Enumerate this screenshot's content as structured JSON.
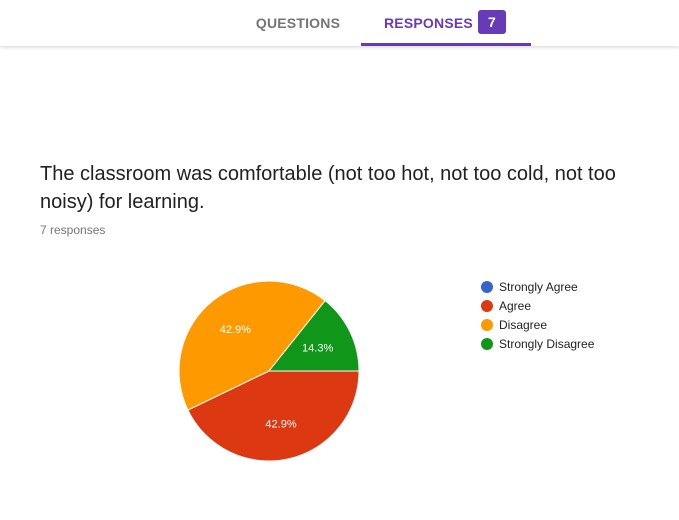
{
  "tabs": {
    "questions_label": "QUESTIONS",
    "responses_label": "RESPONSES",
    "responses_count": "7"
  },
  "question": {
    "title": "The classroom was comfortable (not too hot, not too cold, not too noisy) for learning.",
    "response_count": "7 responses"
  },
  "chart_data": {
    "type": "pie",
    "legend_position": "right",
    "slices": [
      {
        "label": "Strongly Agree",
        "value": 0,
        "percent_label": "",
        "color": "#3366cc"
      },
      {
        "label": "Agree",
        "value": 42.9,
        "percent_label": "42.9%",
        "color": "#dc3912"
      },
      {
        "label": "Disagree",
        "value": 42.9,
        "percent_label": "42.9%",
        "color": "#ff9900"
      },
      {
        "label": "Strongly Disagree",
        "value": 14.3,
        "percent_label": "14.3%",
        "color": "#109618"
      }
    ]
  }
}
